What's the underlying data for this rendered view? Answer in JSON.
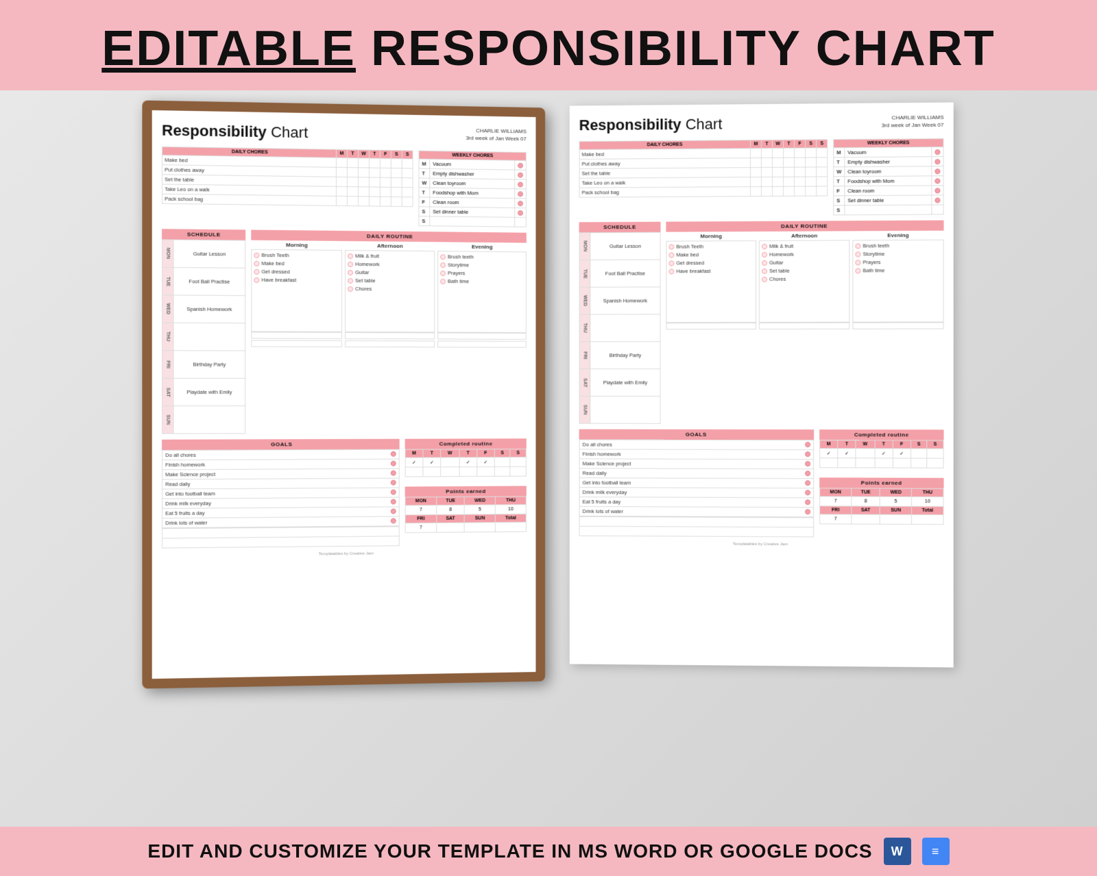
{
  "header": {
    "title_editable": "EDITABLE",
    "title_rest": "RESPONSIBILITY CHART"
  },
  "footer": {
    "text": "EDIT AND CUSTOMIZE YOUR TEMPLATE IN MS WORD OR GOOGLE DOCS"
  },
  "chart": {
    "title_bold": "Responsibility",
    "title_rest": " Chart",
    "meta_name": "CHARLIE WILLIAMS",
    "meta_week": "3rd week of Jan  Week 07",
    "daily_chores_label": "DAILY CHORES",
    "weekly_chores_label": "WEEKLY CHORES",
    "days_header": [
      "M",
      "T",
      "W",
      "T",
      "F",
      "S",
      "S"
    ],
    "daily_chores_items": [
      "Make bed",
      "Put clothes away",
      "Set the table",
      "Take Leo on a walk",
      "Pack school bag"
    ],
    "weekly_chores_items": [
      {
        "day": "M",
        "task": "Vacuum"
      },
      {
        "day": "T",
        "task": "Empty dishwasher"
      },
      {
        "day": "W",
        "task": "Clean toyroom"
      },
      {
        "day": "T",
        "task": "Foodshop with Mom"
      },
      {
        "day": "F",
        "task": "Clean room"
      },
      {
        "day": "S",
        "task": "Set dinner table"
      },
      {
        "day": "S",
        "task": ""
      }
    ],
    "schedule_label": "SCHEDULE",
    "daily_routine_label": "DAILY ROUTINE",
    "schedule_days": [
      {
        "day": "MON",
        "event": "Guitar Lesson"
      },
      {
        "day": "TUE",
        "event": "Foot Ball Practise"
      },
      {
        "day": "WED",
        "event": "Spanish Homework"
      },
      {
        "day": "THU",
        "event": ""
      },
      {
        "day": "FRI",
        "event": "Birthday Party"
      },
      {
        "day": "SAT",
        "event": "Playdate with Emily"
      },
      {
        "day": "SUN",
        "event": ""
      }
    ],
    "routine_morning_label": "Morning",
    "routine_afternoon_label": "Afternoon",
    "routine_evening_label": "Evening",
    "routine_morning_items": [
      "Brush Teeth",
      "Make bed",
      "Get dressed",
      "Have breakfast"
    ],
    "routine_afternoon_items": [
      "Milk & fruit",
      "Homework",
      "Guitar",
      "Set table",
      "Chores"
    ],
    "routine_evening_items": [
      "Brush teeth",
      "Storytime",
      "Prayers",
      "Bath time"
    ],
    "goals_label": "GOALS",
    "goals_items": [
      "Do all chores",
      "Finish homework",
      "Make Science project",
      "Read daily",
      "Get into football team",
      "Drink milk everyday",
      "Eat 5 fruits a day",
      "Drink lots of water"
    ],
    "completed_routine_label": "Completed routine",
    "completed_days": [
      "M",
      "T",
      "W",
      "T",
      "F",
      "S",
      "S"
    ],
    "completed_checks": [
      "✓",
      "✓",
      "",
      "✓",
      "✓",
      "",
      ""
    ],
    "points_earned_label": "Points earned",
    "points_days_row1": [
      "MON",
      "TUE",
      "WED",
      "THU"
    ],
    "points_vals_row1": [
      "7",
      "8",
      "5",
      "10"
    ],
    "points_days_row2": [
      "FRI",
      "SAT",
      "SUN",
      "Total"
    ],
    "points_vals_row2": [
      "7",
      "",
      "",
      ""
    ],
    "template_credit": "Templatables by Creative Jam"
  }
}
